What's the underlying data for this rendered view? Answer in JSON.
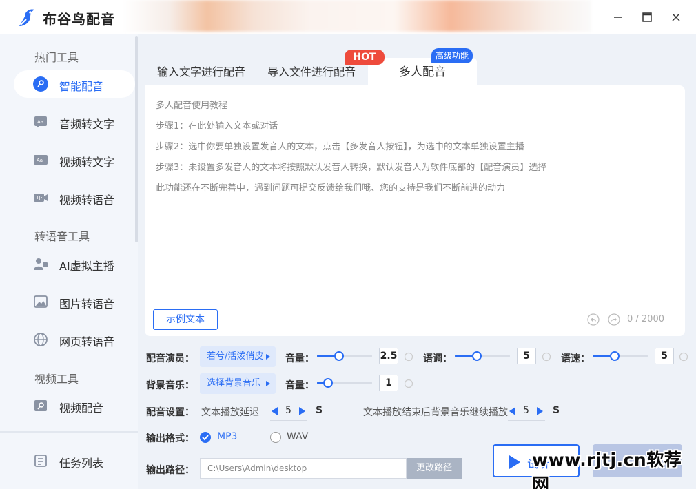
{
  "app": {
    "title": "布谷鸟配音"
  },
  "window": {
    "minimize": "minimize",
    "maximize": "maximize",
    "close": "close"
  },
  "sidebar": {
    "sections": [
      {
        "title": "热门工具"
      },
      {
        "title": "转语音工具"
      },
      {
        "title": "视频工具"
      }
    ],
    "items": [
      {
        "label": "智能配音",
        "icon": "mic-icon",
        "active": true
      },
      {
        "label": "音频转文字",
        "icon": "audio-text-icon"
      },
      {
        "label": "视频转文字",
        "icon": "video-text-icon"
      },
      {
        "label": "视频转语音",
        "icon": "video-voice-icon"
      },
      {
        "label": "AI虚拟主播",
        "icon": "ai-anchor-icon"
      },
      {
        "label": "图片转语音",
        "icon": "image-icon"
      },
      {
        "label": "网页转语音",
        "icon": "globe-icon"
      },
      {
        "label": "视频配音",
        "icon": "video-dub-icon"
      }
    ],
    "task_list": {
      "label": "任务列表",
      "icon": "list-icon"
    }
  },
  "tabs": [
    {
      "label": "输入文字进行配音"
    },
    {
      "label": "导入文件进行配音"
    },
    {
      "label": "多人配音",
      "active": true
    }
  ],
  "badges": {
    "hot": "HOT",
    "advanced": "高级功能"
  },
  "editor": {
    "lines": [
      "多人配音使用教程",
      "步骤1：在此处输入文本或对话",
      "步骤2：选中你要单独设置发音人的文本，点击【多发音人按钮】，为选中的文本单独设置主播",
      "步骤3：未设置多发音人的文本将按照默认发音人转换，默认发音人为软件底部的【配音演员】选择",
      "此功能还在不断完善中，遇到问题可提交反馈给我们哦、您的支持是我们不断前进的动力"
    ],
    "sample_button": "示例文本",
    "char_count": "0 / 2000"
  },
  "settings": {
    "voice_actor": {
      "label": "配音演员：",
      "value": "若兮/活泼俏皮"
    },
    "volume_label": "音量：",
    "pitch_label": "语调：",
    "speed_label": "语速：",
    "voice_volume": {
      "value": "2.5",
      "fraction": 0.4
    },
    "pitch": {
      "value": "5",
      "fraction": 0.4
    },
    "speed": {
      "value": "5",
      "fraction": 0.4
    },
    "bgm": {
      "label": "背景音乐：",
      "value": "选择背景音乐"
    },
    "bgm_volume": {
      "value": "1",
      "fraction": 0.2
    },
    "dub_settings": {
      "label": "配音设置：",
      "delay_label": "文本播放延迟",
      "delay_value": "5",
      "delay_unit": "S",
      "continue_label": "文本播放结束后背景音乐继续播放",
      "continue_value": "5",
      "continue_unit": "S"
    },
    "output_format": {
      "label": "输出格式：",
      "options": [
        "MP3",
        "WAV"
      ],
      "selected": "MP3"
    },
    "output_path": {
      "label": "输出路径：",
      "value": "C:\\Users\\Admin\\desktop",
      "change_button": "更改路径"
    }
  },
  "actions": {
    "play_label": "试听"
  },
  "watermark": "www.rjtj.cn软荐网",
  "colors": {
    "accent": "#2a6df4",
    "hot": "#ee4b3c",
    "sidebar_bg": "#f3f6fb",
    "bg": "#eef2f8"
  }
}
